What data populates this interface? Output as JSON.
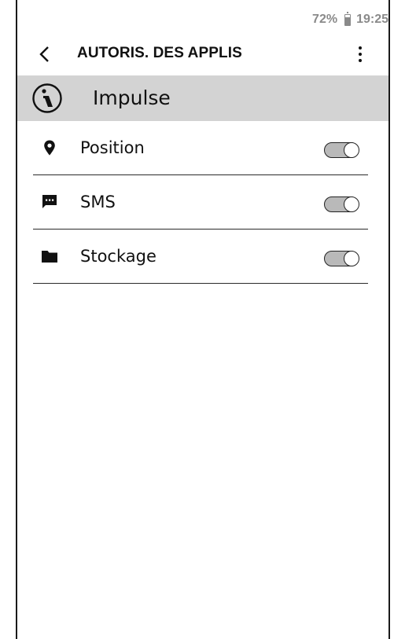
{
  "status_bar": {
    "battery_text": "72%",
    "battery_level": 0.72,
    "time": "19:25"
  },
  "app_bar": {
    "title": "AUTORIS. DES APPLIS",
    "back_icon": "chevron-left-icon",
    "more_icon": "more-vertical-icon"
  },
  "app_header": {
    "icon": "info-icon",
    "app_name": "Impulse"
  },
  "permissions": [
    {
      "label": "Position",
      "icon": "location-pin-icon",
      "enabled": false
    },
    {
      "label": "SMS",
      "icon": "message-icon",
      "enabled": false
    },
    {
      "label": "Stockage",
      "icon": "folder-icon",
      "enabled": false
    }
  ],
  "colors": {
    "header_background": "#d3d3d3",
    "status_text": "#8a8a8a",
    "toggle_track": "#b9b9b9"
  }
}
